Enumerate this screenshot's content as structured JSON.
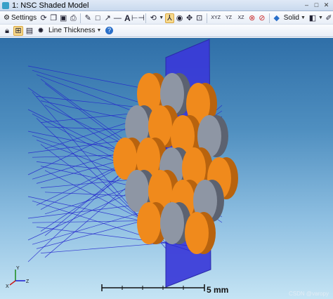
{
  "window": {
    "title": "1: NSC Shaded Model"
  },
  "toolbar1": {
    "settings_label": "Settings",
    "solid_label": "Solid"
  },
  "toolbar2": {
    "line_thickness_label": "Line Thickness"
  },
  "viewport": {
    "scale_label": "5 mm",
    "watermark": "CSDN @varopy"
  },
  "colors": {
    "lens_orange": "#f08a1c",
    "lens_gray": "#8e96a4",
    "detector_blue": "#3a3ad8",
    "ray_blue": "#2222cc",
    "background_top": "#2f6fa8",
    "background_bottom": "#c5e4f4"
  },
  "icons": [
    "settings-icon",
    "refresh-icon",
    "copy-icon",
    "save-icon",
    "print-icon",
    "pencil-icon",
    "rectangle-icon",
    "arrow-icon",
    "line-icon",
    "text-icon",
    "dimension-icon",
    "rotate-icon",
    "axis-icon",
    "camera-icon",
    "pan-icon",
    "zoom-fit-icon",
    "xyz-view-icon",
    "reset-icon",
    "hide-icon",
    "cube-icon",
    "color-icon",
    "lock-icon",
    "frame-icon",
    "window-icon",
    "gear-icon",
    "help-icon"
  ]
}
